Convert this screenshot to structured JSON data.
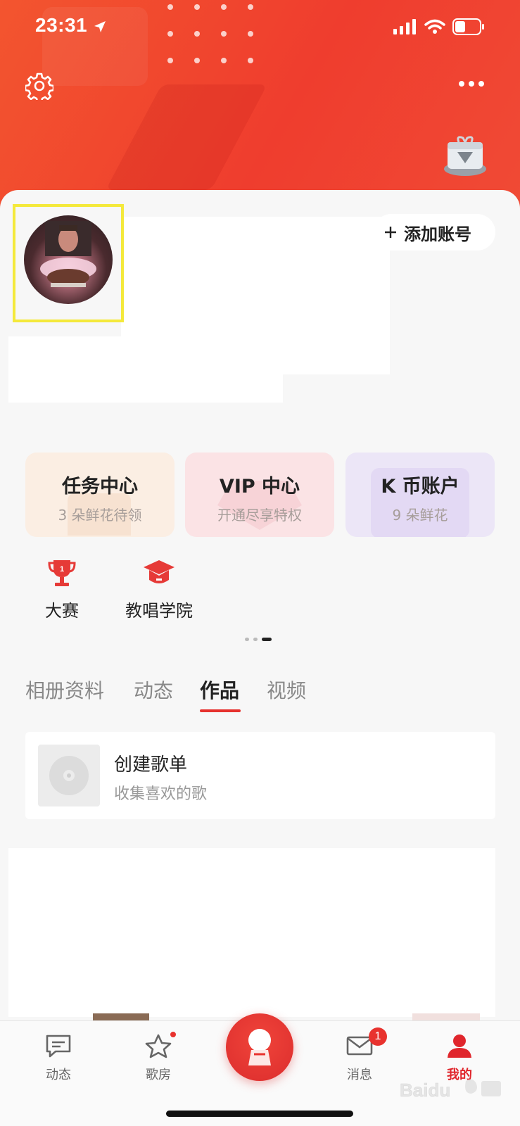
{
  "status_bar": {
    "time": "23:31"
  },
  "header": {
    "settings_icon": "gear-icon",
    "more_icon": "more-dots-icon",
    "gift_icon": "gift-box-icon"
  },
  "profile": {
    "add_account_label": "添加账号"
  },
  "features": [
    {
      "title": "任务中心",
      "subtitle": "3 朵鲜花待领"
    },
    {
      "title": "VIP 中心",
      "subtitle": "开通尽享特权"
    },
    {
      "title": "K 币账户",
      "subtitle": "9 朵鲜花"
    }
  ],
  "shortcuts": [
    {
      "label": "大赛",
      "icon": "trophy-icon"
    },
    {
      "label": "教唱学院",
      "icon": "graduation-cap-icon"
    }
  ],
  "tabs": [
    {
      "label": "相册资料",
      "active": false
    },
    {
      "label": "动态",
      "active": false
    },
    {
      "label": "作品",
      "active": true
    },
    {
      "label": "视频",
      "active": false
    }
  ],
  "playlist": {
    "title": "创建歌单",
    "subtitle": "收集喜欢的歌"
  },
  "bottom_nav": [
    {
      "label": "动态",
      "icon": "message-icon",
      "badge": ""
    },
    {
      "label": "歌房",
      "icon": "star-icon",
      "badge": "dot"
    },
    {
      "label": "",
      "icon": "sing-icon",
      "badge": ""
    },
    {
      "label": "消息",
      "icon": "mail-icon",
      "badge": "1"
    },
    {
      "label": "我的",
      "icon": "person-icon",
      "badge": "",
      "active": true
    }
  ],
  "colors": {
    "accent": "#e6322e",
    "header_start": "#f3552f",
    "header_end": "#ef3d2e"
  }
}
